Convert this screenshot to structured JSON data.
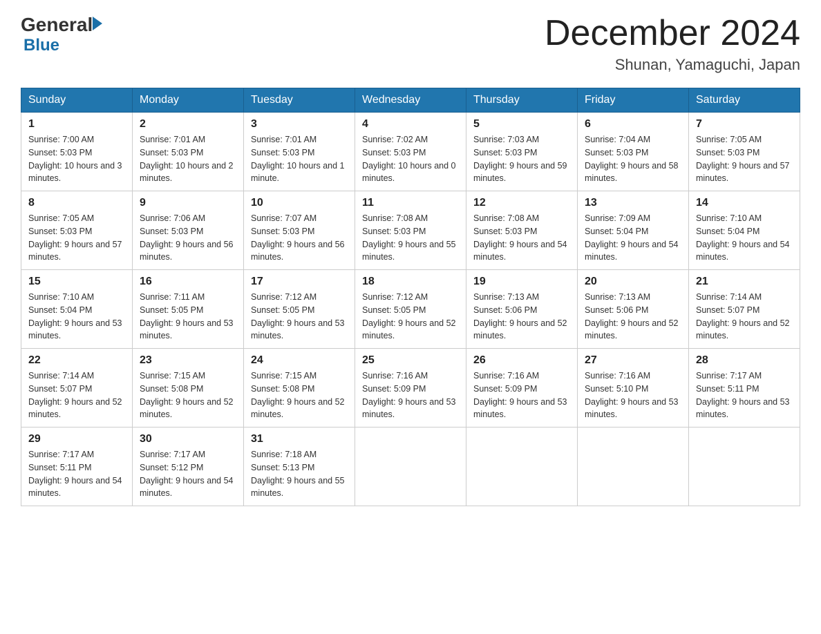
{
  "header": {
    "logo_general": "General",
    "logo_blue": "Blue",
    "month_title": "December 2024",
    "location": "Shunan, Yamaguchi, Japan"
  },
  "weekdays": [
    "Sunday",
    "Monday",
    "Tuesday",
    "Wednesday",
    "Thursday",
    "Friday",
    "Saturday"
  ],
  "weeks": [
    [
      {
        "day": "1",
        "sunrise": "7:00 AM",
        "sunset": "5:03 PM",
        "daylight": "10 hours and 3 minutes."
      },
      {
        "day": "2",
        "sunrise": "7:01 AM",
        "sunset": "5:03 PM",
        "daylight": "10 hours and 2 minutes."
      },
      {
        "day": "3",
        "sunrise": "7:01 AM",
        "sunset": "5:03 PM",
        "daylight": "10 hours and 1 minute."
      },
      {
        "day": "4",
        "sunrise": "7:02 AM",
        "sunset": "5:03 PM",
        "daylight": "10 hours and 0 minutes."
      },
      {
        "day": "5",
        "sunrise": "7:03 AM",
        "sunset": "5:03 PM",
        "daylight": "9 hours and 59 minutes."
      },
      {
        "day": "6",
        "sunrise": "7:04 AM",
        "sunset": "5:03 PM",
        "daylight": "9 hours and 58 minutes."
      },
      {
        "day": "7",
        "sunrise": "7:05 AM",
        "sunset": "5:03 PM",
        "daylight": "9 hours and 57 minutes."
      }
    ],
    [
      {
        "day": "8",
        "sunrise": "7:05 AM",
        "sunset": "5:03 PM",
        "daylight": "9 hours and 57 minutes."
      },
      {
        "day": "9",
        "sunrise": "7:06 AM",
        "sunset": "5:03 PM",
        "daylight": "9 hours and 56 minutes."
      },
      {
        "day": "10",
        "sunrise": "7:07 AM",
        "sunset": "5:03 PM",
        "daylight": "9 hours and 56 minutes."
      },
      {
        "day": "11",
        "sunrise": "7:08 AM",
        "sunset": "5:03 PM",
        "daylight": "9 hours and 55 minutes."
      },
      {
        "day": "12",
        "sunrise": "7:08 AM",
        "sunset": "5:03 PM",
        "daylight": "9 hours and 54 minutes."
      },
      {
        "day": "13",
        "sunrise": "7:09 AM",
        "sunset": "5:04 PM",
        "daylight": "9 hours and 54 minutes."
      },
      {
        "day": "14",
        "sunrise": "7:10 AM",
        "sunset": "5:04 PM",
        "daylight": "9 hours and 54 minutes."
      }
    ],
    [
      {
        "day": "15",
        "sunrise": "7:10 AM",
        "sunset": "5:04 PM",
        "daylight": "9 hours and 53 minutes."
      },
      {
        "day": "16",
        "sunrise": "7:11 AM",
        "sunset": "5:05 PM",
        "daylight": "9 hours and 53 minutes."
      },
      {
        "day": "17",
        "sunrise": "7:12 AM",
        "sunset": "5:05 PM",
        "daylight": "9 hours and 53 minutes."
      },
      {
        "day": "18",
        "sunrise": "7:12 AM",
        "sunset": "5:05 PM",
        "daylight": "9 hours and 52 minutes."
      },
      {
        "day": "19",
        "sunrise": "7:13 AM",
        "sunset": "5:06 PM",
        "daylight": "9 hours and 52 minutes."
      },
      {
        "day": "20",
        "sunrise": "7:13 AM",
        "sunset": "5:06 PM",
        "daylight": "9 hours and 52 minutes."
      },
      {
        "day": "21",
        "sunrise": "7:14 AM",
        "sunset": "5:07 PM",
        "daylight": "9 hours and 52 minutes."
      }
    ],
    [
      {
        "day": "22",
        "sunrise": "7:14 AM",
        "sunset": "5:07 PM",
        "daylight": "9 hours and 52 minutes."
      },
      {
        "day": "23",
        "sunrise": "7:15 AM",
        "sunset": "5:08 PM",
        "daylight": "9 hours and 52 minutes."
      },
      {
        "day": "24",
        "sunrise": "7:15 AM",
        "sunset": "5:08 PM",
        "daylight": "9 hours and 52 minutes."
      },
      {
        "day": "25",
        "sunrise": "7:16 AM",
        "sunset": "5:09 PM",
        "daylight": "9 hours and 53 minutes."
      },
      {
        "day": "26",
        "sunrise": "7:16 AM",
        "sunset": "5:09 PM",
        "daylight": "9 hours and 53 minutes."
      },
      {
        "day": "27",
        "sunrise": "7:16 AM",
        "sunset": "5:10 PM",
        "daylight": "9 hours and 53 minutes."
      },
      {
        "day": "28",
        "sunrise": "7:17 AM",
        "sunset": "5:11 PM",
        "daylight": "9 hours and 53 minutes."
      }
    ],
    [
      {
        "day": "29",
        "sunrise": "7:17 AM",
        "sunset": "5:11 PM",
        "daylight": "9 hours and 54 minutes."
      },
      {
        "day": "30",
        "sunrise": "7:17 AM",
        "sunset": "5:12 PM",
        "daylight": "9 hours and 54 minutes."
      },
      {
        "day": "31",
        "sunrise": "7:18 AM",
        "sunset": "5:13 PM",
        "daylight": "9 hours and 55 minutes."
      },
      null,
      null,
      null,
      null
    ]
  ]
}
